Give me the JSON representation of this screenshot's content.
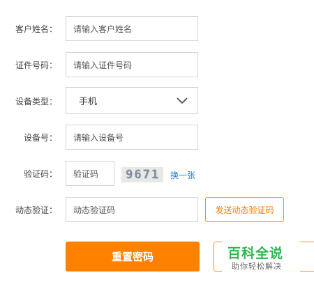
{
  "form": {
    "name": {
      "label": "客户姓名：",
      "placeholder": "请输入客户姓名"
    },
    "id": {
      "label": "证件号码：",
      "placeholder": "请输入证件号码"
    },
    "device_type": {
      "label": "设备类型：",
      "selected": "手机"
    },
    "device_no": {
      "label": "设备号：",
      "placeholder": "请输入设备号"
    },
    "captcha": {
      "label": "验证码：",
      "placeholder": "验证码",
      "image_text": "9671",
      "refresh_label": "换一张"
    },
    "sms": {
      "label": "动态验证：",
      "placeholder": "动态验证码",
      "send_label": "发送动态验证码"
    }
  },
  "actions": {
    "reset_label": "重置密码"
  },
  "watermark": {
    "title": "百科全说",
    "subtitle": "助你轻松解决"
  },
  "colors": {
    "accent": "#ff8100",
    "link": "#2a78c2",
    "watermark": "#2db84d"
  },
  "icons": {
    "select": "chevron-down-icon"
  }
}
